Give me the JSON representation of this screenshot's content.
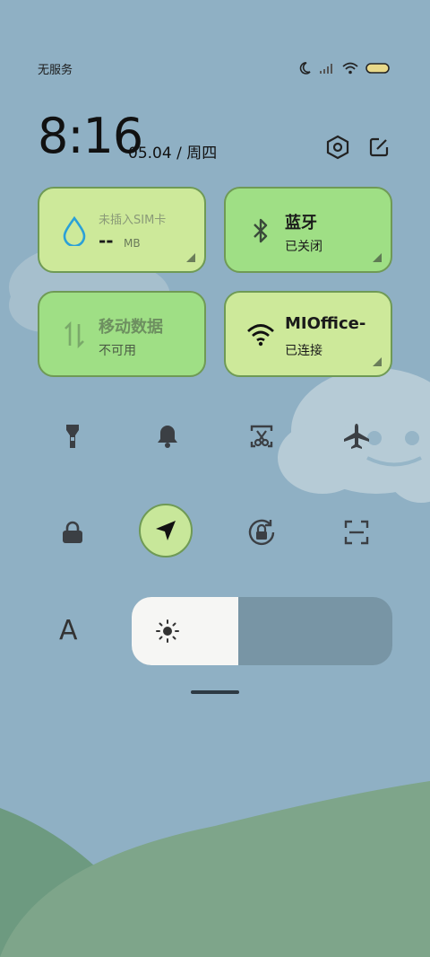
{
  "status_bar": {
    "carrier": "无服务",
    "icons": [
      "moon-icon",
      "cell-signal-icon",
      "wifi-icon",
      "battery-icon"
    ]
  },
  "header": {
    "time": "8:16",
    "date": "05.04 / 周四",
    "actions": [
      "settings-hex-icon",
      "edit-icon"
    ]
  },
  "tiles": {
    "sim": {
      "title": "未插入SIM卡",
      "value": "--",
      "unit": "MB",
      "icon": "water-drop-icon"
    },
    "bluetooth": {
      "title": "蓝牙",
      "status": "已关闭",
      "icon": "bluetooth-icon"
    },
    "mobile_data": {
      "title": "移动数据",
      "status": "不可用",
      "icon": "data-arrows-icon"
    },
    "wifi": {
      "title": "MIOffice-",
      "status": "已连接",
      "icon": "wifi-icon"
    }
  },
  "toggles": {
    "row1": [
      "flashlight-icon",
      "bell-icon",
      "screenshot-scissors-icon",
      "airplane-icon"
    ],
    "row2": [
      "lock-icon",
      "location-arrow-icon",
      "rotation-lock-icon",
      "scan-icon"
    ],
    "location_active": true
  },
  "brightness": {
    "label_icon": "font-size-icon",
    "font_label": "A",
    "level": 0.41,
    "icon": "sun-icon"
  },
  "colors": {
    "tile_light": "#cde99a",
    "tile_green": "#9fdf85",
    "tile_border": "#6f9a55",
    "background": "#8fb0c4",
    "hill": "#7ea58a"
  }
}
